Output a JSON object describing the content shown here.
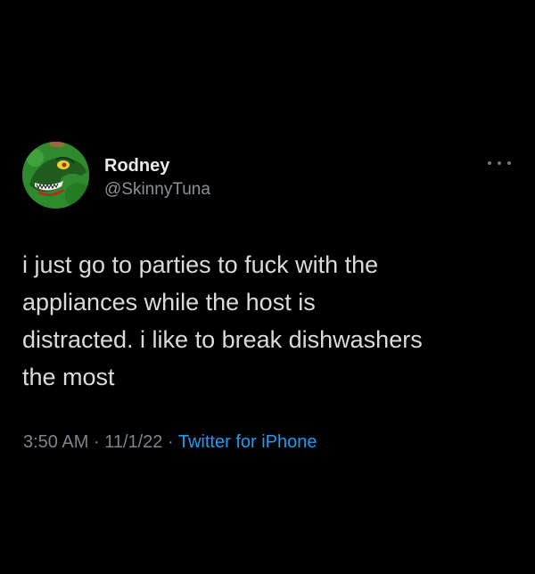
{
  "tweet": {
    "author": {
      "display_name": "Rodney",
      "handle": "@SkinnyTuna",
      "avatar_icon": "green-dinosaur-avatar-icon"
    },
    "more_icon": "more-options-icon",
    "text": "i just go to parties to fuck with the\nappliances while the host is\ndistracted. i like to break dishwashers\nthe most",
    "time": "3:50 AM",
    "separator": "·",
    "date": "11/1/22",
    "source": "Twitter for iPhone"
  },
  "colors": {
    "background": "#000000",
    "text": "#e7e9ea",
    "secondary_text": "#8b9197",
    "link": "#1d9bf0",
    "avatar_green": "#2e8a2c"
  }
}
